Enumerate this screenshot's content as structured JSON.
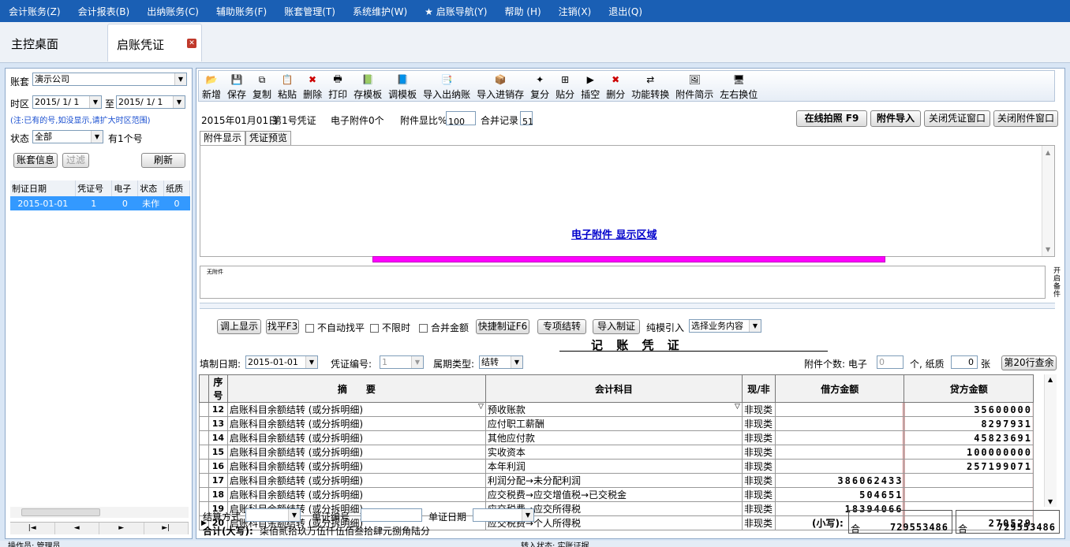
{
  "menu": [
    "会计账务(Z)",
    "会计报表(B)",
    "出纳账务(C)",
    "辅助账务(F)",
    "账套管理(T)",
    "系统维护(W)",
    "★ 启账导航(Y)",
    "帮助 (H)",
    "注销(X)",
    "退出(Q)"
  ],
  "tabs": {
    "home": "主控桌面",
    "active": "启账凭证"
  },
  "left": {
    "account_set_label": "账套",
    "account_set_value": "演示公司",
    "period_label": "时区",
    "period_from": "2015/ 1/ 1",
    "period_to_label": "至",
    "period_to": "2015/ 1/ 1",
    "note": "(注:已有的号,如没显示,请扩大时区范围)",
    "status_label": "状态",
    "status_value": "全部",
    "count": "有1个号",
    "btn_info": "账套信息",
    "btn_filter": "过滤",
    "btn_refresh": "刷新",
    "table_headers": [
      "制证日期",
      "凭证号",
      "电子",
      "状态",
      "纸质"
    ],
    "rows": [
      [
        "2015-01-01",
        "1",
        "0",
        "未作",
        "0"
      ]
    ],
    "nav": [
      "|◄",
      "◄",
      "►",
      "►|"
    ]
  },
  "toolbar": [
    "新增",
    "保存",
    "复制",
    "粘贴",
    "删除",
    "打印",
    "存模板",
    "调模板",
    "导入出纳账",
    "导入进销存",
    "复分",
    "贴分",
    "插空",
    "删分",
    "功能转换",
    "附件简示",
    "左右换位"
  ],
  "info": {
    "date": "2015年01月01日",
    "vno": "第1号凭证",
    "ecount": "电子附件0个",
    "ratio_label": "附件显比%",
    "ratio": "100",
    "merge_label": "合并记录",
    "merge": "51",
    "btn_photo": "在线拍照 F9",
    "btn_import": "附件导入",
    "btn_close_v": "关闭凭证窗口",
    "btn_close_a": "关闭附件窗口"
  },
  "subtabs": [
    "附件显示",
    "凭证预览"
  ],
  "attach_text": "电子附件   显示区域",
  "small_caption": "无附件",
  "side_label": "开启备件",
  "vtool": {
    "show": "调上显示",
    "balance": "找平F3",
    "no_auto": "不自动找平",
    "no_limit": "不限时",
    "merge_amt": "合并金额",
    "quick": "快捷制证F6",
    "special": "专项结转",
    "import": "导入制证",
    "pure": "纯模引入",
    "select": "选择业务内容"
  },
  "voucher_title": "记 账 凭 证",
  "hdr": {
    "date_label": "填制日期:",
    "date": "2015-01-01",
    "vno_label": "凭证编号:",
    "vno": "1",
    "type_label": "属期类型:",
    "type": "结转",
    "att_label": "附件个数: 电子",
    "att_e": "0",
    "att_mid": "个, 纸质",
    "att_p": "0",
    "att_end": "张",
    "btn_check": "第20行查余"
  },
  "grid_headers": [
    "序号",
    "摘　　要",
    "会计科目",
    "现/非",
    "借方金额",
    "贷方金额"
  ],
  "grid_rows": [
    {
      "n": "12",
      "summary": "启账科目余额结转 (或分拆明细)",
      "account": "预收账款",
      "cash": "非现类",
      "debit": "",
      "credit": "35600000"
    },
    {
      "n": "13",
      "summary": "启账科目余额结转 (或分拆明细)",
      "account": "应付职工薪酬",
      "cash": "非现类",
      "debit": "",
      "credit": "8297931"
    },
    {
      "n": "14",
      "summary": "启账科目余额结转 (或分拆明细)",
      "account": "其他应付款",
      "cash": "非现类",
      "debit": "",
      "credit": "45823691"
    },
    {
      "n": "15",
      "summary": "启账科目余额结转 (或分拆明细)",
      "account": "实收资本",
      "cash": "非现类",
      "debit": "",
      "credit": "100000000"
    },
    {
      "n": "16",
      "summary": "启账科目余额结转 (或分拆明细)",
      "account": "本年利润",
      "cash": "非现类",
      "debit": "",
      "credit": "257199071"
    },
    {
      "n": "17",
      "summary": "启账科目余额结转 (或分拆明细)",
      "account": "利润分配→未分配利润",
      "cash": "非现类",
      "debit": "386062433",
      "credit": ""
    },
    {
      "n": "18",
      "summary": "启账科目余额结转 (或分拆明细)",
      "account": "应交税费→应交增值税→已交税金",
      "cash": "非现类",
      "debit": "504651",
      "credit": ""
    },
    {
      "n": "19",
      "summary": "启账科目余额结转 (或分拆明细)",
      "account": "应交税费→应交所得税",
      "cash": "非现类",
      "debit": "18394066",
      "credit": ""
    },
    {
      "n": "20",
      "summary": "启账科目余额结转 (或分拆明细)",
      "account": "应交税费→个人所得税",
      "cash": "非现类",
      "debit": "",
      "credit": "270529"
    }
  ],
  "footer": {
    "settle_label": "结算方式",
    "bill_label": "单证编号",
    "bill_date_label": "单证日期",
    "total_label": "合计(大写):",
    "total_text": "柒佰贰拾玖万伍仟伍佰叁拾肆元捌角陆分",
    "small_label": "(小写):",
    "he": "合",
    "debit_total": "729553486",
    "credit_total": "729553486"
  },
  "status": {
    "user": "操作员: 管理员",
    "mid": "转入状态: 实账证据"
  }
}
